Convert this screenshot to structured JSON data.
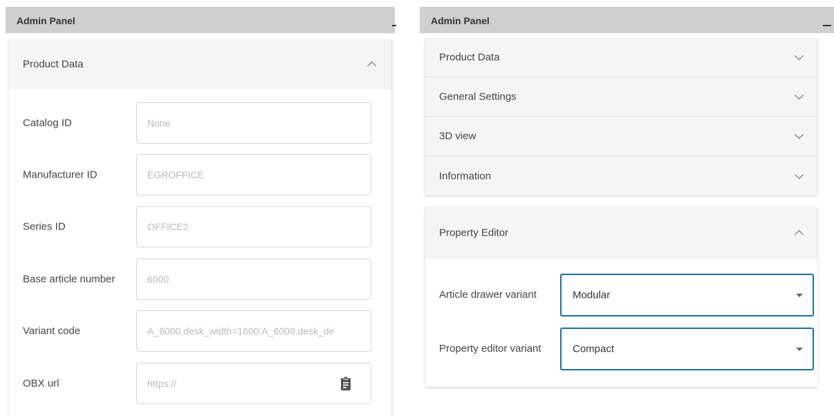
{
  "left_panel": {
    "title": "Admin Panel",
    "section": {
      "label": "Product Data",
      "expanded": true
    },
    "fields": [
      {
        "label": "Catalog ID",
        "value": "None"
      },
      {
        "label": "Manufacturer ID",
        "value": "EGROFFICE"
      },
      {
        "label": "Series ID",
        "value": "OFFICE2"
      },
      {
        "label": "Base article number",
        "value": "6000"
      },
      {
        "label": "Variant code",
        "value": "A_6000.desk_width=1600;A_6000.desk_de"
      },
      {
        "label": "OBX url",
        "placeholder": "https://",
        "icon": "clipboard-icon"
      }
    ]
  },
  "right_panel": {
    "title": "Admin Panel",
    "sections": [
      {
        "label": "Product Data",
        "expanded": false
      },
      {
        "label": "General Settings",
        "expanded": false
      },
      {
        "label": "3D view",
        "expanded": false
      },
      {
        "label": "Information",
        "expanded": false
      }
    ],
    "property_editor": {
      "label": "Property Editor",
      "expanded": true,
      "rows": [
        {
          "label": "Article drawer variant",
          "value": "Modular"
        },
        {
          "label": "Property editor variant",
          "value": "Compact"
        }
      ]
    }
  },
  "colors": {
    "titlebar": "#cfcfcf",
    "header_bg": "#f5f5f5",
    "select_border": "#1a6fa0",
    "placeholder_text": "#b9b9b9"
  }
}
